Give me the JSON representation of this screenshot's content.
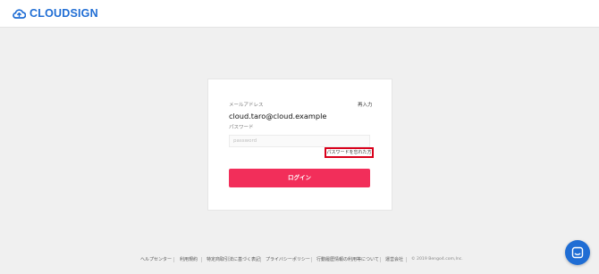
{
  "header": {
    "brand": "CLOUDSIGN",
    "brand_color": "#1f6dd4"
  },
  "login": {
    "email_label": "メールアドレス",
    "reenter_label": "再入力",
    "email_value": "cloud.taro@cloud.example",
    "password_label": "パスワード",
    "password_placeholder": "password",
    "forgot_label": "パスワードを忘れた方",
    "submit_label": "ログイン",
    "accent_color": "#f22e5a",
    "highlight_color": "#d9001b"
  },
  "footer": {
    "links": [
      "ヘルプセンター",
      "利用規約",
      "特定商取引法に基づく表記",
      "プライバシーポリシー",
      "行動履歴情報の利用等について",
      "運営会社"
    ],
    "copyright": "© 2019 Bengo4.com,Inc."
  },
  "chat": {
    "icon": "chat-icon"
  }
}
